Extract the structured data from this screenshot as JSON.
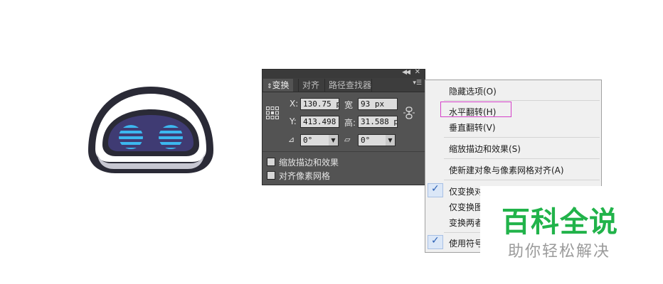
{
  "colors": {
    "panel_bg": "#535353",
    "robot_body": "#2a2a36",
    "robot_face": "#3f3b73",
    "robot_eye": "#3cb7ef",
    "highlight_border": "#d43fc8",
    "watermark_green": "#21b34a"
  },
  "panel": {
    "tabs": [
      {
        "label": "变换",
        "icon": "updown-arrows-icon",
        "active": true
      },
      {
        "label": "对齐",
        "active": false
      },
      {
        "label": "路径查找器",
        "active": false
      }
    ],
    "fields": {
      "x": {
        "label": "X:",
        "value": "130.75 p"
      },
      "width": {
        "label": "宽",
        "value": "93 px"
      },
      "y": {
        "label": "Y:",
        "value": "413.498"
      },
      "height": {
        "label": "高:",
        "value": "31.588 p"
      },
      "rotate": {
        "icon": "rotate-angle-icon",
        "value": "0°"
      },
      "shear": {
        "icon": "shear-icon",
        "value": "0°"
      }
    },
    "checkboxes": [
      {
        "label": "缩放描边和效果",
        "checked": false
      },
      {
        "label": "对齐像素网格",
        "checked": false
      }
    ]
  },
  "menu": {
    "items": [
      {
        "label": "隐藏选项(O)",
        "checked": false
      },
      {
        "label": "水平翻转(H)",
        "checked": false,
        "highlighted": true
      },
      {
        "label": "垂直翻转(V)",
        "checked": false
      },
      {
        "label": "缩放描边和效果(S)",
        "checked": false
      },
      {
        "label": "使新建对象与像素网格对齐(A)",
        "checked": false
      },
      {
        "label": "仅变换对",
        "checked": true
      },
      {
        "label": "仅变换图",
        "checked": false
      },
      {
        "label": "变换两者",
        "checked": false
      },
      {
        "label": "使用符号",
        "checked": true
      }
    ]
  },
  "watermark": {
    "title": "百科全说",
    "subtitle": "助你轻松解决"
  }
}
